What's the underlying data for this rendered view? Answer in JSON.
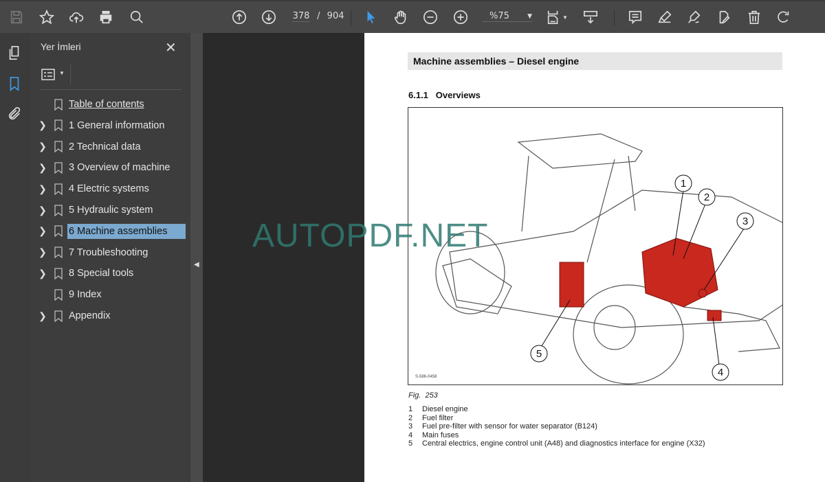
{
  "toolbar": {
    "page_current": "378",
    "page_sep": "/",
    "page_total": "904",
    "zoom": "%75",
    "icons": [
      "save-icon",
      "bookmark-star-icon",
      "upload-cloud-icon",
      "print-icon",
      "find-icon",
      "prev-page-icon",
      "next-page-icon",
      "select-cursor-icon",
      "hand-icon",
      "zoom-out-icon",
      "zoom-in-icon",
      "fit-page-icon",
      "scroll-mode-icon",
      "comment-icon",
      "highlight-icon",
      "sign-icon",
      "edit-pdf-icon",
      "delete-icon",
      "rotate-icon"
    ]
  },
  "sidebar": {
    "title": "Yer İmleri",
    "items": [
      {
        "label": "Table of contents",
        "expandable": false
      },
      {
        "label": "1 General information",
        "expandable": true
      },
      {
        "label": "2 Technical data",
        "expandable": true
      },
      {
        "label": "3 Overview of machine",
        "expandable": true
      },
      {
        "label": "4 Electric systems",
        "expandable": true
      },
      {
        "label": "5 Hydraulic system",
        "expandable": true
      },
      {
        "label": "6 Machine assemblies",
        "expandable": true,
        "selected": true
      },
      {
        "label": "7 Troubleshooting",
        "expandable": true
      },
      {
        "label": "8 Special tools",
        "expandable": true
      },
      {
        "label": "9 Index",
        "expandable": false
      },
      {
        "label": "Appendix",
        "expandable": true
      }
    ]
  },
  "document": {
    "header": "Machine assemblies – Diesel engine",
    "section": "6.1.1   Overviews",
    "figure_code": "S-586-0458",
    "callouts": [
      "1",
      "2",
      "3",
      "4",
      "5"
    ],
    "caption": "Fig.  253",
    "legend": [
      {
        "n": "1",
        "text": "Diesel engine"
      },
      {
        "n": "2",
        "text": "Fuel filter"
      },
      {
        "n": "3",
        "text": "Fuel pre-filter with sensor for water separator (B124)"
      },
      {
        "n": "4",
        "text": "Main fuses"
      },
      {
        "n": "5",
        "text": "Central electrics, engine control unit (A48) and diagnostics interface for engine (X32)"
      }
    ]
  },
  "watermark": "AUTOPDF.NET",
  "colors": {
    "accent": "#3d9be9",
    "selection": "#7ba9cf",
    "engine": "#c8281e",
    "watermark": "#2f7a70"
  }
}
